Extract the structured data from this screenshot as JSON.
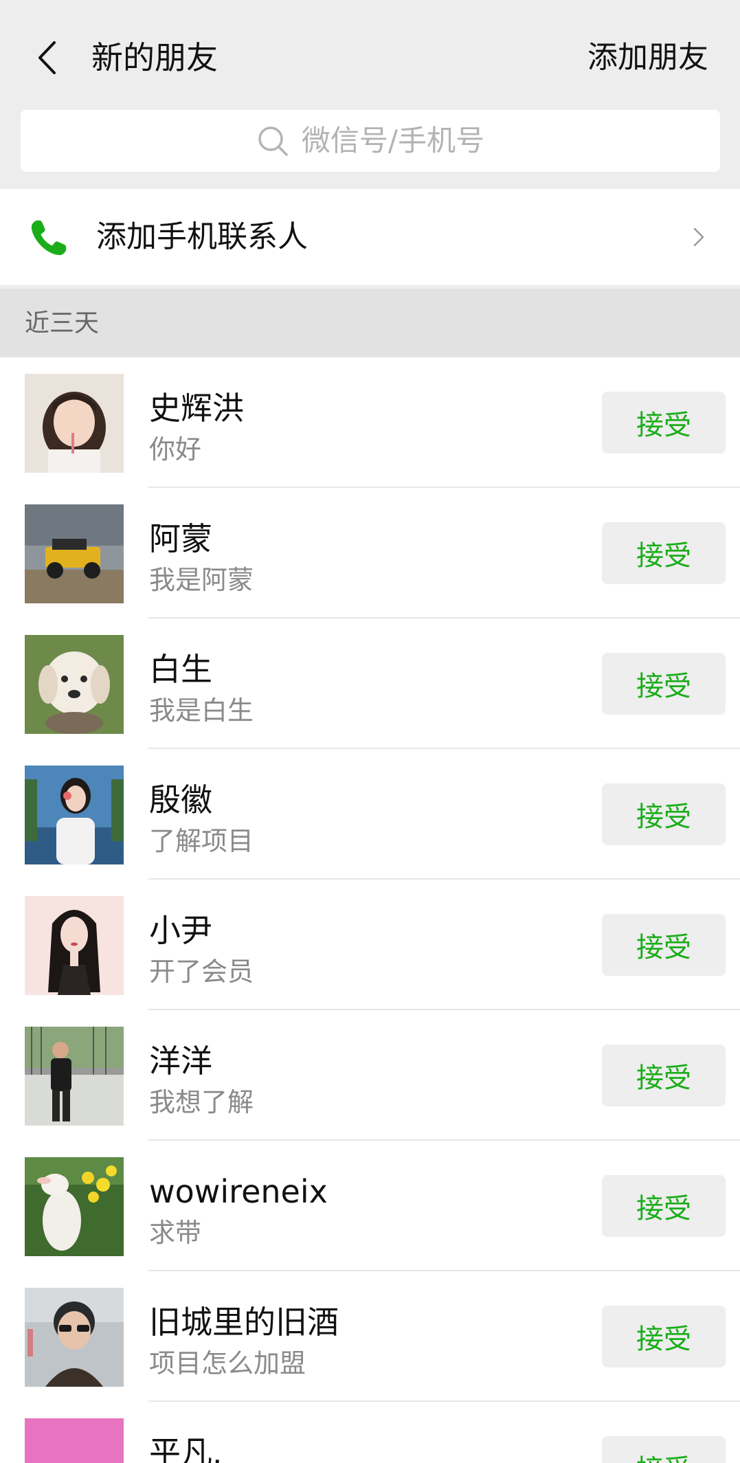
{
  "header": {
    "title": "新的朋友",
    "add_friend_label": "添加朋友"
  },
  "search": {
    "placeholder": "微信号/手机号"
  },
  "phone_contacts": {
    "label": "添加手机联系人"
  },
  "section": {
    "label": "近三天"
  },
  "accept_label": "接受",
  "colors": {
    "accent_green": "#1aad19",
    "background": "#ededed",
    "section_bg": "#e2e2e2"
  },
  "friends": [
    {
      "name": "史辉洪",
      "message": "你好",
      "avatar": "girl-photo-avatar"
    },
    {
      "name": "阿蒙",
      "message": "我是阿蒙",
      "avatar": "jeep-photo-avatar"
    },
    {
      "name": "白生",
      "message": "我是白生",
      "avatar": "puppy-photo-avatar"
    },
    {
      "name": "殷徽",
      "message": "了解项目",
      "avatar": "woman-photo-avatar"
    },
    {
      "name": "小尹",
      "message": "开了会员",
      "avatar": "illustrated-woman-avatar"
    },
    {
      "name": "洋洋",
      "message": "我想了解",
      "avatar": "man-photo-avatar"
    },
    {
      "name": "wowireneix",
      "message": "求带",
      "avatar": "lamb-flowers-avatar"
    },
    {
      "name": "旧城里的旧酒",
      "message": "项目怎么加盟",
      "avatar": "man-glasses-avatar"
    },
    {
      "name": "平凡.",
      "message": "",
      "avatar": "pink-avatar"
    }
  ]
}
